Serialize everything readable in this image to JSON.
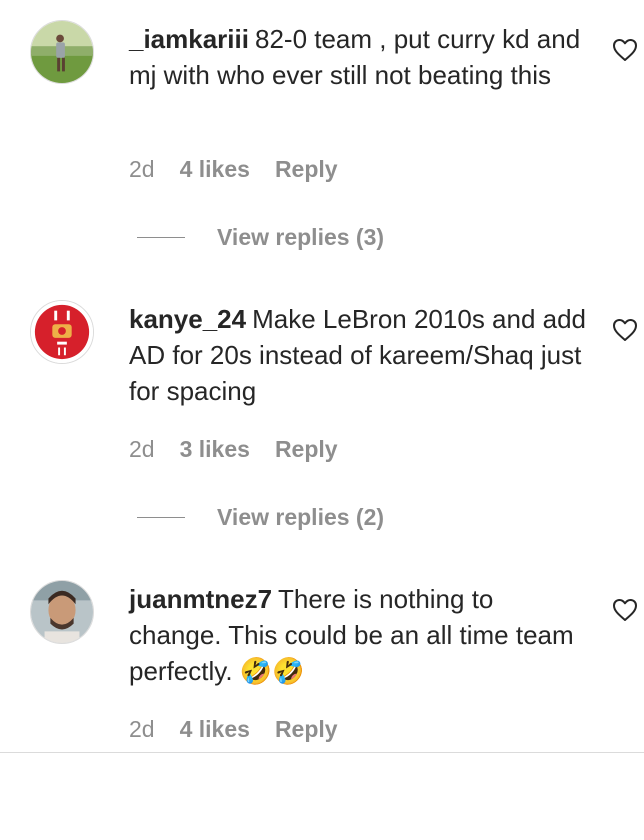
{
  "comments": [
    {
      "username": "_iamkariii",
      "text": "82-0 team , put curry kd and mj with who ever still not beating this",
      "time": "2d",
      "likes": "4 likes",
      "reply_label": "Reply",
      "view_replies": "View replies (3)"
    },
    {
      "username": "kanye_24",
      "text": "Make LeBron 2010s and add AD for 20s instead of kareem/Shaq just for spacing",
      "time": "2d",
      "likes": "3 likes",
      "reply_label": "Reply",
      "view_replies": "View replies (2)"
    },
    {
      "username": "juanmtnez7",
      "text": "There is nothing to change. This could be an all time team perfectly. 🤣🤣",
      "time": "2d",
      "likes": "4 likes",
      "reply_label": "Reply"
    }
  ],
  "icons": {
    "like": "heart-outline-icon"
  },
  "colors": {
    "text": "#262626",
    "secondary": "#8e8e8e",
    "divider": "#dbdbdb"
  }
}
